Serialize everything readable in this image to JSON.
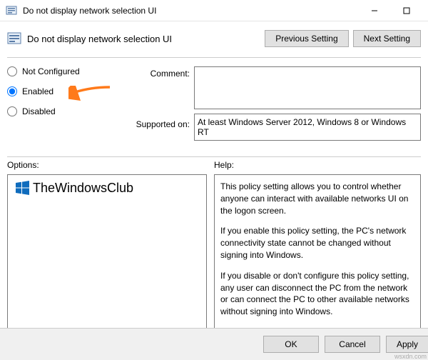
{
  "titlebar": {
    "title": "Do not display network selection UI"
  },
  "header": {
    "title": "Do not display network selection UI",
    "prev_btn": "Previous Setting",
    "next_btn": "Next Setting"
  },
  "radios": {
    "not_configured": "Not Configured",
    "enabled": "Enabled",
    "disabled": "Disabled"
  },
  "fields": {
    "comment_label": "Comment:",
    "comment_value": "",
    "supported_label": "Supported on:",
    "supported_value": "At least Windows Server 2012, Windows 8 or Windows RT"
  },
  "sections": {
    "options_label": "Options:",
    "help_label": "Help:"
  },
  "help": {
    "p1": "This policy setting allows you to control whether anyone can interact with available networks UI on the logon screen.",
    "p2": "If you enable this policy setting, the PC's network connectivity state cannot be changed without signing into Windows.",
    "p3": "If you disable or don't configure this policy setting, any user can disconnect the PC from the network or can connect the PC to other available networks without signing into Windows."
  },
  "footer": {
    "ok": "OK",
    "cancel": "Cancel",
    "apply": "Apply"
  },
  "watermark": {
    "text": "TheWindowsClub"
  },
  "corner": "wsxdn.com"
}
